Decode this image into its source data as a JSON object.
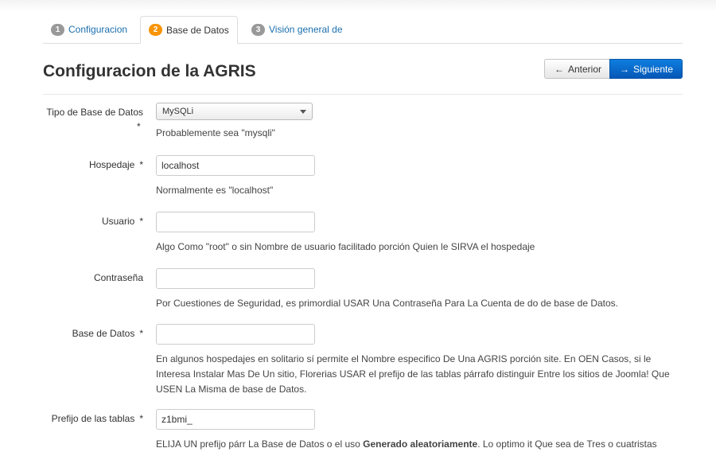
{
  "steps": [
    {
      "num": "1",
      "label": "Configuracion"
    },
    {
      "num": "2",
      "label": "Base de Datos"
    },
    {
      "num": "3",
      "label": "Visión general de"
    }
  ],
  "page_title": "Configuracion de la AGRIS",
  "nav": {
    "prev_label": "Anterior",
    "next_label": "Siguiente"
  },
  "form": {
    "db_type": {
      "label": "Tipo de Base de Datos",
      "required_mark": "*",
      "value": "MySQLi",
      "help": "Probablemente sea \"mysqli\""
    },
    "host": {
      "label": "Hospedaje",
      "required_mark": "*",
      "value": "localhost",
      "help": "Normalmente es \"localhost\""
    },
    "user": {
      "label": "Usuario",
      "required_mark": "*",
      "value": "",
      "help": "Algo Como \"root\" o sin Nombre de usuario facilitado porción Quien le SIRVA el hospedaje"
    },
    "password": {
      "label": "Contraseña",
      "value": "",
      "help": "Por Cuestiones de Seguridad, es primordial USAR Una Contraseña Para La Cuenta de do de base de Datos."
    },
    "db_name": {
      "label": "Base de Datos",
      "required_mark": "*",
      "value": "",
      "help": "En algunos hospedajes en solitario sí permite el Nombre especifico De Una AGRIS porción site. En OEN Casos, si le Interesa Instalar Mas De Un sitio, Florerias USAR el prefijo de las tablas párrafo distinguir Entre los sitios de Joomla! Que USEN La Misma de base de Datos."
    },
    "prefix": {
      "label": "Prefijo de las tablas",
      "required_mark": "*",
      "value": "z1bmi_",
      "help_start": "ELIJA UN prefijo párr La Base de Datos o el uso ",
      "help_bold": "Generado aleatoriamente",
      "help_end": ". Lo optimo it Que sea de Tres o cuatristas"
    }
  },
  "colors": {
    "link": "#1a6fae",
    "active_step": "#f89406",
    "primary_button": "#0a6dd0"
  }
}
